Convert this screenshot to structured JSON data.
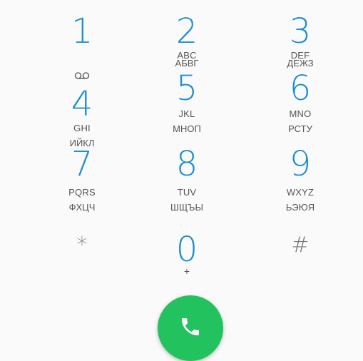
{
  "keypad": {
    "keys": [
      {
        "digit": "1",
        "letters": "",
        "cyrillic": ""
      },
      {
        "digit": "2",
        "letters": "ABC",
        "cyrillic": "АБВГ"
      },
      {
        "digit": "3",
        "letters": "DEF",
        "cyrillic": "ДЕЖЗ"
      },
      {
        "digit": "4",
        "letters": "GHI",
        "cyrillic": "ИЙКЛ"
      },
      {
        "digit": "5",
        "letters": "JKL",
        "cyrillic": "МНОП"
      },
      {
        "digit": "6",
        "letters": "MNO",
        "cyrillic": "РСТУ"
      },
      {
        "digit": "7",
        "letters": "PQRS",
        "cyrillic": "ФХЦЧ"
      },
      {
        "digit": "8",
        "letters": "TUV",
        "cyrillic": "ШЩЪЫ"
      },
      {
        "digit": "9",
        "letters": "WXYZ",
        "cyrillic": "ЬЭЮЯ"
      },
      {
        "symbol": "*"
      },
      {
        "digit": "0",
        "sub": "+"
      },
      {
        "symbol": "#"
      }
    ]
  },
  "icons": {
    "voicemail": "voicemail-icon",
    "call": "phone-icon"
  },
  "colors": {
    "digit": "#1e8fd3",
    "call_button": "#22c35e",
    "background": "#fafafa"
  }
}
